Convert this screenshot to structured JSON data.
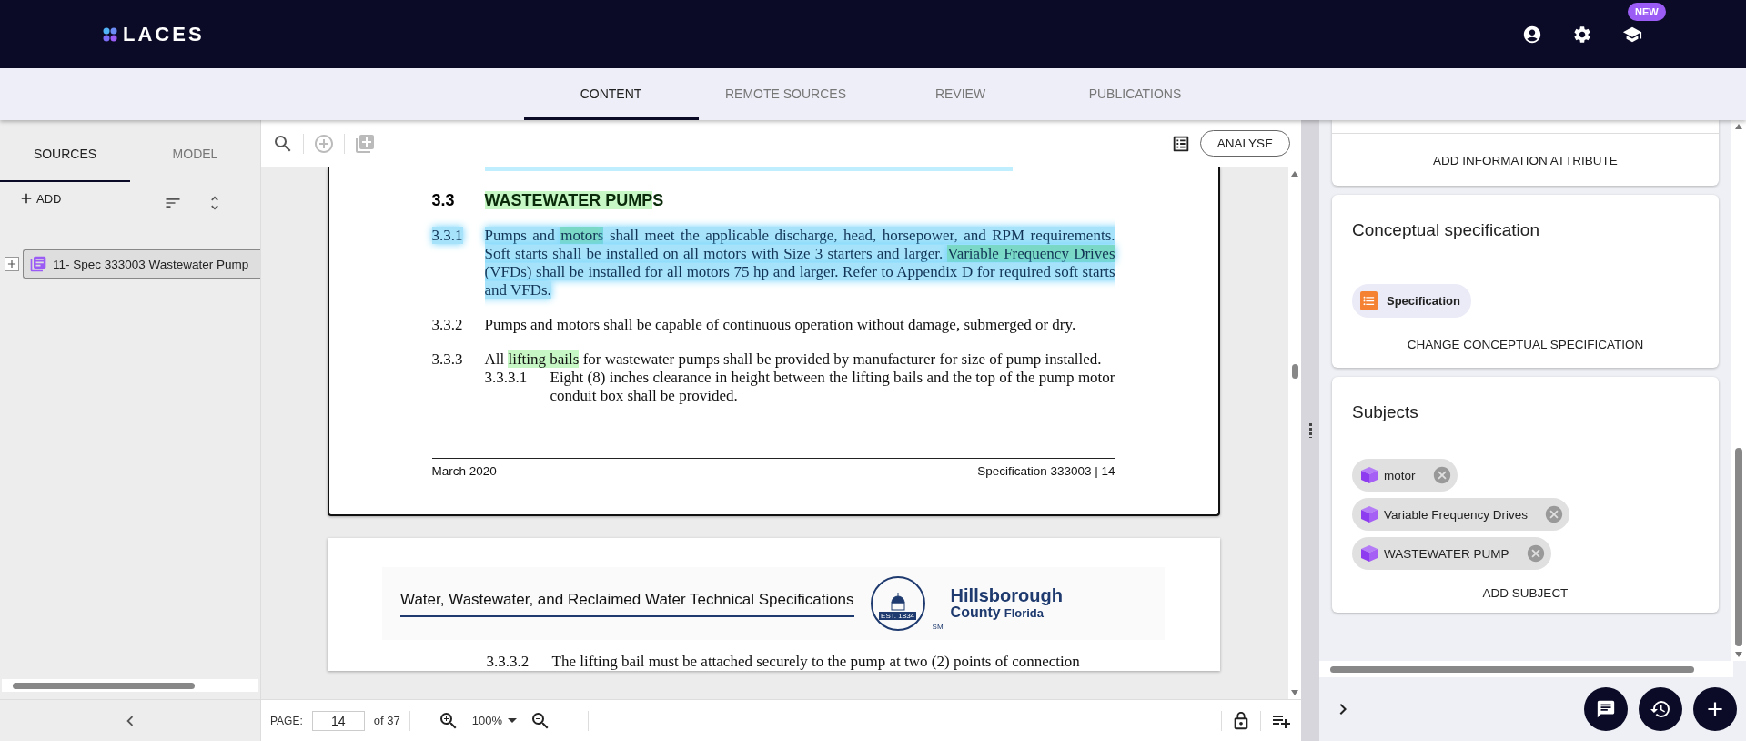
{
  "header": {
    "logo": "LACES",
    "badge": "NEW"
  },
  "main_tabs": [
    {
      "label": "CONTENT",
      "selected": true
    },
    {
      "label": "REMOTE SOURCES",
      "selected": false
    },
    {
      "label": "REVIEW",
      "selected": false
    },
    {
      "label": "PUBLICATIONS",
      "selected": false
    }
  ],
  "sources_panel": {
    "tabs": [
      {
        "label": "SOURCES",
        "selected": true
      },
      {
        "label": "MODEL",
        "selected": false
      }
    ],
    "add_label": "ADD",
    "tree": [
      {
        "label": "11- Spec 333003 Wastewater Pump",
        "expanded": false
      }
    ]
  },
  "viewer": {
    "analyse_label": "ANALYSE",
    "page1": {
      "section_number": "3.3",
      "section_title": [
        {
          "text": "WASTEWATER PUMP",
          "kind": "green"
        },
        {
          "text": "S",
          "kind": "plain"
        }
      ],
      "clauses": [
        {
          "number": "3.3.1",
          "highlighted": true,
          "segments": [
            {
              "text": "Pumps and ",
              "kind": "plain"
            },
            {
              "text": "motors",
              "kind": "teal"
            },
            {
              "text": " shall meet the applicable discharge, head, horsepower, and RPM requirements. Soft starts shall be installed on all motors with Size 3 starters and larger.  ",
              "kind": "plain"
            },
            {
              "text": "Variable Frequency Drives",
              "kind": "teal"
            },
            {
              "text": " (VFDs) shall be installed for all motors 75 hp and larger. Refer to Appendix D for required soft starts and VFDs.",
              "kind": "plain"
            }
          ]
        },
        {
          "number": "3.3.2",
          "highlighted": false,
          "segments": [
            {
              "text": "Pumps and motors shall be capable of continuous operation without damage, submerged or dry.",
              "kind": "plain"
            }
          ]
        },
        {
          "number": "3.3.3",
          "highlighted": false,
          "segments": [
            {
              "text": "All ",
              "kind": "plain"
            },
            {
              "text": "lifting bails",
              "kind": "green"
            },
            {
              "text": " for wastewater pumps shall be provided by manufacturer for size of pump installed.",
              "kind": "plain"
            }
          ],
          "children": [
            {
              "number": "3.3.3.1",
              "text": "Eight (8) inches clearance in height between the lifting bails and the top of the pump motor conduit box shall be provided."
            }
          ]
        }
      ],
      "footer_left": "March 2020",
      "footer_right": "Specification 333003 | 14"
    },
    "page2": {
      "banner_title": "Water, Wastewater, and Reclaimed Water Technical Specifications",
      "logo_name": "Hillsborough",
      "logo_county": "County",
      "logo_state": "Florida",
      "logo_seal": "EST. 1834",
      "logo_mark": "SM",
      "clauses": [
        {
          "number": "3.3.3.2",
          "text": "The lifting bail must be attached securely to the pump at two (2) points of connection"
        }
      ]
    },
    "page_label": "PAGE:",
    "page_value": "14",
    "page_total": "of 37",
    "zoom": "100%"
  },
  "details": {
    "add_attribute": "ADD INFORMATION ATTRIBUTE",
    "conceptual": {
      "title": "Conceptual specification",
      "chip": "Specification",
      "action": "CHANGE CONCEPTUAL SPECIFICATION"
    },
    "subjects": {
      "title": "Subjects",
      "chips": [
        "motor",
        "Variable Frequency Drives",
        "WASTEWATER PUMP"
      ],
      "action": "ADD SUBJECT"
    }
  }
}
